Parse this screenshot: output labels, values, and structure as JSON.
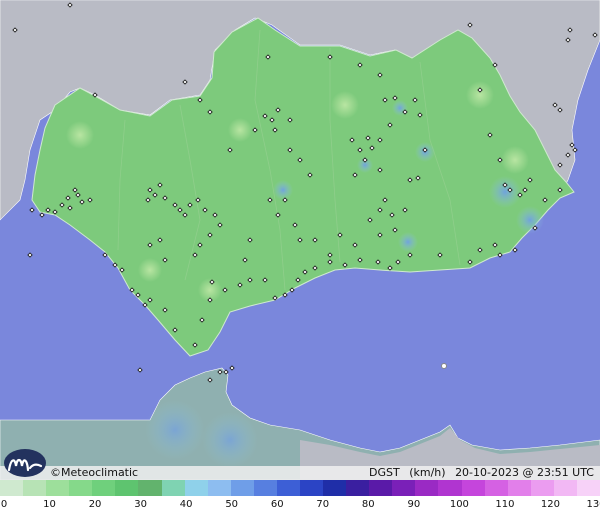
{
  "footer": {
    "brand": "©Meteoclimatic",
    "variable": "DGST",
    "unit": "(km/h)",
    "timestamp": "20-10-2023 @ 23:51 UTC"
  },
  "legend": {
    "ticks": [
      "0",
      "10",
      "20",
      "30",
      "40",
      "50",
      "60",
      "70",
      "80",
      "90",
      "100",
      "110",
      "120",
      "130"
    ],
    "colors": [
      "#cfe9cf",
      "#b7e3b5",
      "#9ddf9b",
      "#85d98a",
      "#6fd07c",
      "#5ec46f",
      "#62b36d",
      "#7fd3b2",
      "#8fd1ea",
      "#8dbdf0",
      "#6f9ee8",
      "#577fe0",
      "#3d5fd6",
      "#2b44c5",
      "#1f2ea8",
      "#3a1fa0",
      "#5a1aa8",
      "#7a20b8",
      "#9a2ac4",
      "#b035d0",
      "#c545dc",
      "#d561e3",
      "#e27fea",
      "#eb9cf0",
      "#f2b8f4",
      "#f7d2f8"
    ]
  },
  "map": {
    "colors": {
      "sea": "#7a87dc",
      "land_outside": "#b9bbc5",
      "andalusia": "#7dca7c",
      "morocco_land": "#8fb0b0"
    }
  }
}
